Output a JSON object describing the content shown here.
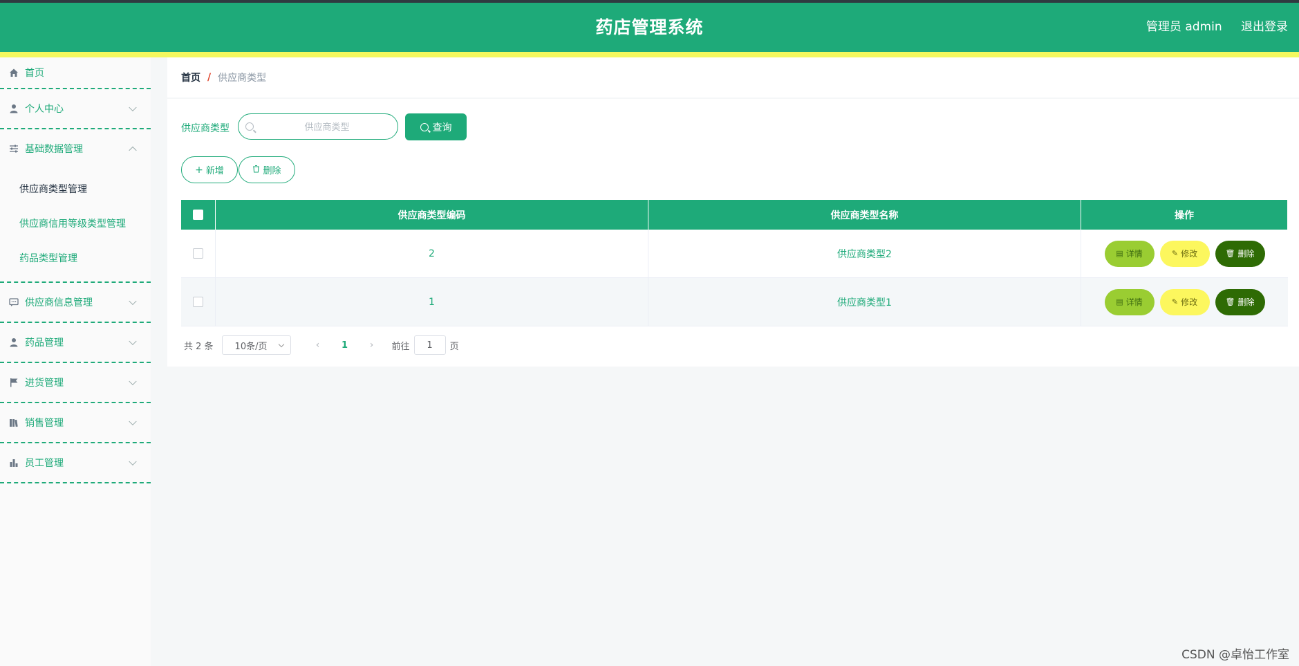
{
  "header": {
    "title": "药店管理系统",
    "user_label": "管理员 admin",
    "logout_label": "退出登录"
  },
  "sidebar": {
    "items": [
      {
        "label": "首页",
        "icon": "home-icon"
      },
      {
        "label": "个人中心",
        "icon": "user-icon"
      },
      {
        "label": "基础数据管理",
        "icon": "sliders-icon",
        "expanded": true,
        "children": [
          "供应商类型管理",
          "供应商信用等级类型管理",
          "药品类型管理"
        ]
      },
      {
        "label": "供应商信息管理",
        "icon": "chat-icon"
      },
      {
        "label": "药品管理",
        "icon": "user-icon"
      },
      {
        "label": "进货管理",
        "icon": "flag-icon"
      },
      {
        "label": "销售管理",
        "icon": "books-icon"
      },
      {
        "label": "员工管理",
        "icon": "bar-chart-icon"
      }
    ],
    "active_child": "供应商类型管理"
  },
  "breadcrumb": {
    "home": "首页",
    "separator": "/",
    "current": "供应商类型"
  },
  "search": {
    "label": "供应商类型",
    "placeholder": "供应商类型",
    "value": "",
    "query_label": "查询"
  },
  "actions": {
    "add_label": "新增",
    "delete_label": "删除"
  },
  "table": {
    "columns": [
      "供应商类型编码",
      "供应商类型名称",
      "操作"
    ],
    "rows": [
      {
        "code": "2",
        "name": "供应商类型2"
      },
      {
        "code": "1",
        "name": "供应商类型1"
      }
    ],
    "row_actions": {
      "detail": "详情",
      "edit": "修改",
      "delete": "删除"
    }
  },
  "pagination": {
    "total_text": "共 2 条",
    "page_size": "10条/页",
    "current_page": "1",
    "goto_prefix": "前往",
    "goto_value": "1",
    "goto_suffix": "页"
  },
  "watermark": "CSDN @卓怡工作室",
  "colors": {
    "primary": "#1eaa79",
    "accent_yellow": "#f4f85e",
    "detail_btn": "#9acd32",
    "edit_btn": "#fcf75e",
    "delete_btn": "#2e6b04"
  }
}
